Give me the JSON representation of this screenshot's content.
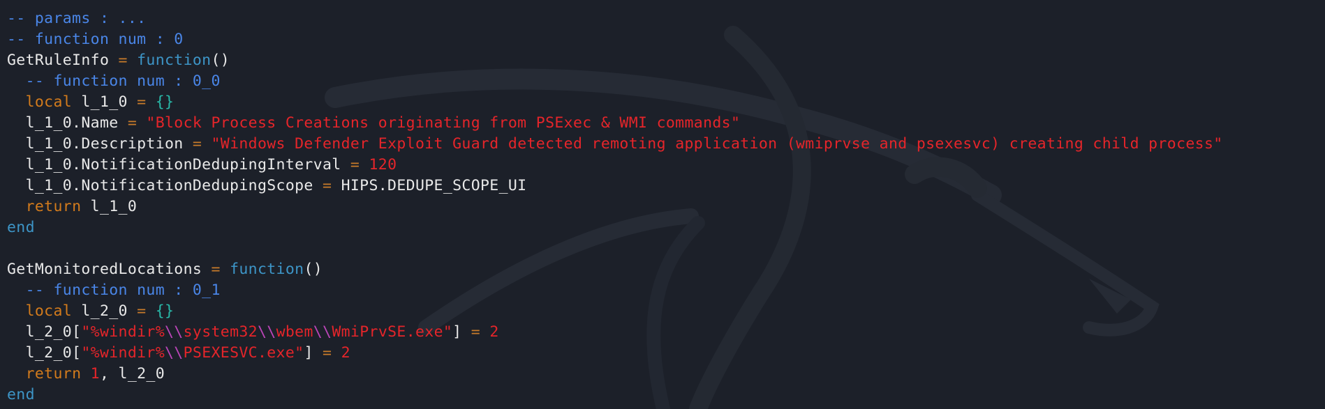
{
  "editor": {
    "lines": [
      [
        [
          "cm",
          "-- params : ..."
        ]
      ],
      [
        [
          "cm",
          "-- function num : 0"
        ]
      ],
      [
        [
          "id",
          "GetRuleInfo "
        ],
        [
          "op",
          "="
        ],
        [
          "id",
          " "
        ],
        [
          "kw",
          "function"
        ],
        [
          "pun",
          "()"
        ]
      ],
      [
        [
          "id",
          "  "
        ],
        [
          "cm",
          "-- function num : 0_0"
        ]
      ],
      [
        [
          "id",
          "  "
        ],
        [
          "loc",
          "local"
        ],
        [
          "id",
          " l_1_0 "
        ],
        [
          "op",
          "="
        ],
        [
          "id",
          " "
        ],
        [
          "br",
          "{}"
        ]
      ],
      [
        [
          "id",
          "  l_1_0.Name "
        ],
        [
          "op",
          "="
        ],
        [
          "id",
          " "
        ],
        [
          "str",
          "\"Block Process Creations originating from PSExec & WMI commands\""
        ]
      ],
      [
        [
          "id",
          "  l_1_0.Description "
        ],
        [
          "op",
          "="
        ],
        [
          "id",
          " "
        ],
        [
          "str",
          "\"Windows Defender Exploit Guard detected remoting application (wmiprvse and psexesvc) creating child process\""
        ]
      ],
      [
        [
          "id",
          "  l_1_0.NotificationDedupingInterval "
        ],
        [
          "op",
          "="
        ],
        [
          "id",
          " "
        ],
        [
          "num",
          "120"
        ]
      ],
      [
        [
          "id",
          "  l_1_0.NotificationDedupingScope "
        ],
        [
          "op",
          "="
        ],
        [
          "id",
          " HIPS.DEDUPE_SCOPE_UI"
        ]
      ],
      [
        [
          "id",
          "  "
        ],
        [
          "loc",
          "return"
        ],
        [
          "id",
          " l_1_0"
        ]
      ],
      [
        [
          "kw",
          "end"
        ]
      ],
      [],
      [
        [
          "id",
          "GetMonitoredLocations "
        ],
        [
          "op",
          "="
        ],
        [
          "id",
          " "
        ],
        [
          "kw",
          "function"
        ],
        [
          "pun",
          "()"
        ]
      ],
      [
        [
          "id",
          "  "
        ],
        [
          "cm",
          "-- function num : 0_1"
        ]
      ],
      [
        [
          "id",
          "  "
        ],
        [
          "loc",
          "local"
        ],
        [
          "id",
          " l_2_0 "
        ],
        [
          "op",
          "="
        ],
        [
          "id",
          " "
        ],
        [
          "br",
          "{}"
        ]
      ],
      [
        [
          "id",
          "  l_2_0["
        ],
        [
          "str",
          "\"%windir%"
        ],
        [
          "esc",
          "\\\\"
        ],
        [
          "str",
          "system32"
        ],
        [
          "esc",
          "\\\\"
        ],
        [
          "str",
          "wbem"
        ],
        [
          "esc",
          "\\\\"
        ],
        [
          "str",
          "WmiPrvSE.exe\""
        ],
        [
          "id",
          "] "
        ],
        [
          "op",
          "="
        ],
        [
          "id",
          " "
        ],
        [
          "num",
          "2"
        ]
      ],
      [
        [
          "id",
          "  l_2_0["
        ],
        [
          "str",
          "\"%windir%"
        ],
        [
          "esc",
          "\\\\"
        ],
        [
          "str",
          "PSEXESVC.exe\""
        ],
        [
          "id",
          "] "
        ],
        [
          "op",
          "="
        ],
        [
          "id",
          " "
        ],
        [
          "num",
          "2"
        ]
      ],
      [
        [
          "id",
          "  "
        ],
        [
          "loc",
          "return"
        ],
        [
          "id",
          " "
        ],
        [
          "num",
          "1"
        ],
        [
          "id",
          ", l_2_0"
        ]
      ],
      [
        [
          "kw",
          "end"
        ]
      ]
    ]
  },
  "colors": {
    "background": "#1c2029",
    "comment": "#4a86e8",
    "keyword": "#3d95c7",
    "local_return": "#d37b1c",
    "string": "#e5252a",
    "escape": "#bb45b8",
    "table_braces": "#29b8a8"
  }
}
